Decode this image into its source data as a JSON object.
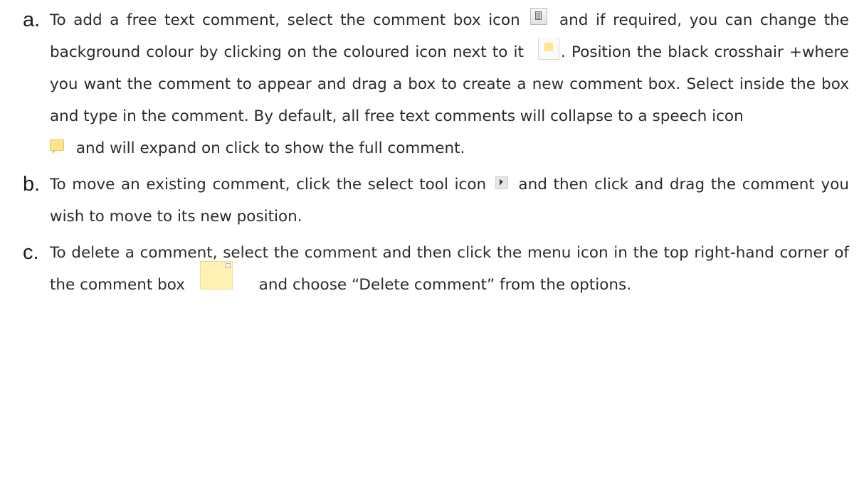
{
  "items": [
    {
      "marker": "a.",
      "t1": "To add a free text comment, select the comment box icon",
      "icon1": "comment-box-icon",
      "t2": "and if required, you can change the background colour by clicking on the coloured icon next to it",
      "icon2": "colour-swatch-icon",
      "t3": ". Position the black crosshair +where you want the comment to appear and drag a box to create a new comment box. Select inside the box and type in the comment. By default, all free text comments will collapse to a speech icon",
      "icon3": "speech-icon",
      "t4": "and will expand on click to show the full comment."
    },
    {
      "marker": "b.",
      "t1": "To move an existing comment, click the select tool icon",
      "icon1": "select-tool-icon",
      "t2": "and then click and drag the comment you wish to move to its new position."
    },
    {
      "marker": "c.",
      "t1": "To delete a comment, select the comment and then click the menu icon in the top right-hand corner of the comment box",
      "icon1": "comment-box-corner-icon",
      "t2": "and choose “Delete comment” from the options."
    }
  ],
  "colors": {
    "text": "#2b2b2b",
    "swatch": "#ffe689",
    "comment_box": "#fff0b4"
  }
}
